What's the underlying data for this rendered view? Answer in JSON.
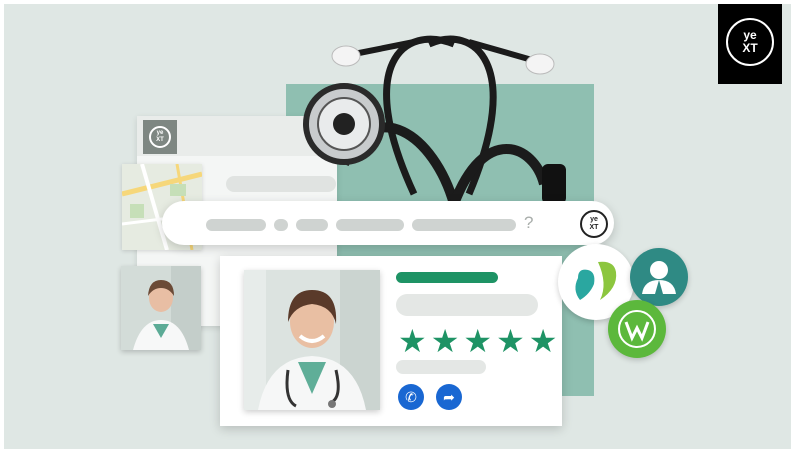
{
  "brand": {
    "logo_line1": "ye",
    "logo_line2": "XT"
  },
  "listing": {
    "rating_stars": 5,
    "stars_text": "★★★★★",
    "search_hint": "?"
  },
  "icons": {
    "phone": "phone-icon",
    "directions": "directions-icon",
    "phone_glyph": "✆",
    "directions_glyph": "➦"
  },
  "colors": {
    "background": "#dfe7e4",
    "teal_panel": "#8fbfb1",
    "accent_green": "#1e9365",
    "action_blue": "#1967d2",
    "logo_black": "#000000"
  }
}
